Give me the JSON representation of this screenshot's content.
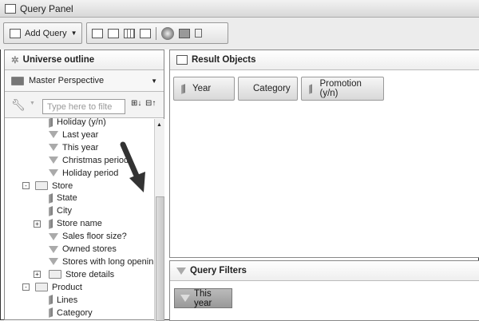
{
  "window": {
    "title": "Query Panel"
  },
  "toolbar": {
    "add_query": "Add Query"
  },
  "left": {
    "title": "Universe outline",
    "perspective": "Master Perspective",
    "filter_placeholder": "Type here to filte",
    "tree": [
      {
        "label": "Holiday (y/n)",
        "type": "dimension",
        "level": 2
      },
      {
        "label": "Last year",
        "type": "filter",
        "level": 2
      },
      {
        "label": "This year",
        "type": "filter",
        "level": 2
      },
      {
        "label": "Christmas period",
        "type": "filter",
        "level": 2
      },
      {
        "label": "Holiday period",
        "type": "filter",
        "level": 2
      },
      {
        "label": "Store",
        "type": "folder-open",
        "level": 1,
        "expander": "-"
      },
      {
        "label": "State",
        "type": "dimension",
        "level": 2
      },
      {
        "label": "City",
        "type": "dimension",
        "level": 2
      },
      {
        "label": "Store name",
        "type": "dimension",
        "level": 2,
        "expander": "+"
      },
      {
        "label": "Sales floor size?",
        "type": "filter",
        "level": 2
      },
      {
        "label": "Owned stores",
        "type": "filter",
        "level": 2
      },
      {
        "label": "Stores with long opening hours",
        "type": "filter",
        "level": 2
      },
      {
        "label": "Store details",
        "type": "folder",
        "level": 2,
        "expander": "+"
      },
      {
        "label": "Product",
        "type": "folder-open",
        "level": 1,
        "expander": "-"
      },
      {
        "label": "Lines",
        "type": "dimension",
        "level": 2
      },
      {
        "label": "Category",
        "type": "dimension",
        "level": 2
      }
    ]
  },
  "result": {
    "title": "Result Objects",
    "objects": [
      "Year",
      "Category",
      "Promotion (y/n)"
    ]
  },
  "filters": {
    "title": "Query Filters",
    "items": [
      "This year"
    ]
  }
}
